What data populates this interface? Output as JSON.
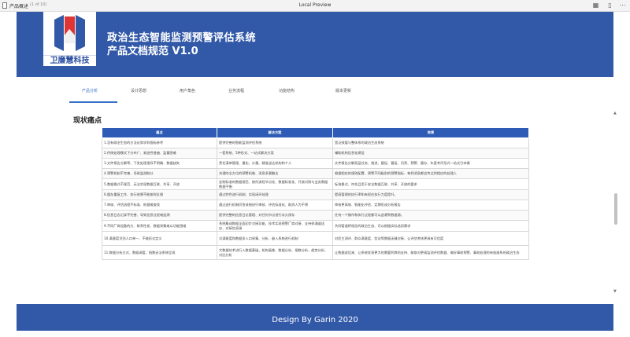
{
  "topbar": {
    "tab_title": "产品概述",
    "pages": "(1 of 10)",
    "window_title": "Local Preview"
  },
  "banner": {
    "logo_caption": "卫廉慧科技",
    "title": "政治生态智能监测预警评估系统",
    "subtitle": "产品文档规范 V1.0"
  },
  "tabs": [
    {
      "label": "产品分析"
    },
    {
      "label": "设计思想"
    },
    {
      "label": "用户角色"
    },
    {
      "label": "业务流程"
    },
    {
      "label": "功能结构"
    },
    {
      "label": "版本更新"
    }
  ],
  "section": {
    "title": "现状痛点"
  },
  "table": {
    "headers": [
      "痛点",
      "解决方案",
      "效果"
    ],
    "rows": [
      [
        "1.没有政治生态的方法论和学科指标参考",
        "提供完善的智能监测评估系统",
        "宽泛效缓与整体系的政治生态系统"
      ],
      [
        "2.传统处理模式下分布广、紧迫性普遍、监督困难",
        "一套系统、5种形式、一站式解决方案",
        "辅助机构信息化建设"
      ],
      [
        "3.文件报告分解等、下发处理指导不明确、数据缺失",
        "责任清单管理、量化、计量、精准送达机构和个人",
        "文件报告分解双层任务、推进、督促、督促、问责、预警、督办、年度考评形式一站式引申操"
      ],
      [
        "4.预警机制不完善、导致监测取分",
        "合理的全方位的预警机制、消息多渠触达",
        "根据相应的规则配置、预警不同级别的预警指标、每到消息都会传达到相应的处理人"
      ],
      [
        "5.数据格式不规范、无法实现数据互联、共享、开放",
        "定制标准的数据规范、按约流程节点化、数据标准化、开放对接与业务数据数据平衡",
        "标准格式、符合且用于安全数据互联、共享、开放的要求"
      ],
      [
        "6.缓存重复工作、执行效果不能按时反馈",
        "通过特色流行机制、实现闭环处理",
        "提高管理的执行率和有权应执行力度提升。"
      ],
      [
        "7.审核、评估流程不标准、依据难查找",
        "通过送行机制问答流制进行审核、评估标准化、取消人为干预",
        "审核更高效、智能化评估、定期形成分析报告"
      ],
      [
        "8.信息日志记录不完善、导致信息过程难追溯",
        "提供完整的信息日志管理、对任何节点进行永久保存",
        "任何一个操作和执行过程都可以追溯到数据源。"
      ],
      [
        "9.不同厂商设备的方、联系性差、数据采集难以功能困难",
        "系统集成数据全面初步对接功能、技术实现预警厂商对接、支持样通道适应、对接信息源",
        "共同管道将现信的政治生态、可以根据实际选用需求"
      ],
      [
        "10.满意度识别人口单一、不能形式定义",
        "对满意度和数据多入口采集、分析、嵌入系统进行机制",
        "对民主测评、群众满意度、信访等数据无缝对接、让评估考核更具有可信度"
      ],
      [
        "11.数据分析方式、数据调度、指数无法系统呈现",
        "大数据技术进行入数据基础，机构画像、数据分析、指数分析、趋势分析、对比分析",
        "让数据说话来、让系统发现更大的需要利弊的支持、能取对更高监测评估数据、做好事前预警、事前处理的有效维系的政治生态"
      ]
    ]
  },
  "footer": {
    "text": "Design By Garin 2020"
  },
  "colors": {
    "brand_blue": "#3259a8",
    "header_blue": "#2d5bb5",
    "active_tab": "#3a6fc8"
  }
}
